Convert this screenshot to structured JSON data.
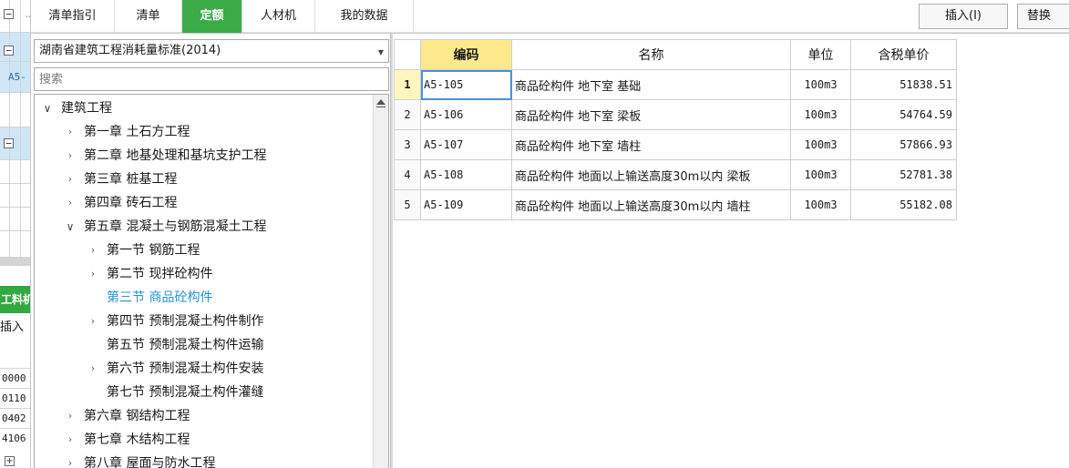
{
  "tabs": [
    {
      "label": "清单指引",
      "active": false
    },
    {
      "label": "清单",
      "active": false
    },
    {
      "label": "定额",
      "active": true
    },
    {
      "label": "人材机",
      "active": false
    },
    {
      "label": "我的数据",
      "active": false
    }
  ],
  "toolbar": {
    "insert_label": "插入(I)",
    "replace_label": "替换"
  },
  "left_strip": {
    "code_text": "A5-",
    "section_label": "工料机",
    "insert_label": "插入",
    "codes": [
      "0000",
      "0110",
      "0402",
      "4106"
    ]
  },
  "library": {
    "selected": "湖南省建筑工程消耗量标准(2014)"
  },
  "search": {
    "placeholder": "搜索"
  },
  "tree": [
    {
      "label": "建筑工程",
      "level": 0,
      "state": "expanded"
    },
    {
      "label": "第一章 土石方工程",
      "level": 1,
      "state": "collapsed"
    },
    {
      "label": "第二章 地基处理和基坑支护工程",
      "level": 1,
      "state": "collapsed"
    },
    {
      "label": "第三章 桩基工程",
      "level": 1,
      "state": "collapsed"
    },
    {
      "label": "第四章 砖石工程",
      "level": 1,
      "state": "collapsed"
    },
    {
      "label": "第五章 混凝土与钢筋混凝土工程",
      "level": 1,
      "state": "expanded"
    },
    {
      "label": "第一节 钢筋工程",
      "level": 2,
      "state": "collapsed"
    },
    {
      "label": "第二节 现拌砼构件",
      "level": 2,
      "state": "collapsed"
    },
    {
      "label": "第三节 商品砼构件",
      "level": 2,
      "state": "leaf",
      "selected": true
    },
    {
      "label": "第四节 预制混凝土构件制作",
      "level": 2,
      "state": "collapsed"
    },
    {
      "label": "第五节 预制混凝土构件运输",
      "level": 2,
      "state": "leaf"
    },
    {
      "label": "第六节 预制混凝土构件安装",
      "level": 2,
      "state": "collapsed"
    },
    {
      "label": "第七节 预制混凝土构件灌缝",
      "level": 2,
      "state": "leaf"
    },
    {
      "label": "第六章 钢结构工程",
      "level": 1,
      "state": "collapsed"
    },
    {
      "label": "第七章 木结构工程",
      "level": 1,
      "state": "collapsed"
    },
    {
      "label": "第八章 屋面与防水工程",
      "level": 1,
      "state": "collapsed"
    }
  ],
  "table": {
    "columns": [
      "编码",
      "名称",
      "单位",
      "含税单价"
    ],
    "rows": [
      {
        "idx": "1",
        "code": "A5-105",
        "name": "商品砼构件 地下室 基础",
        "unit": "100m3",
        "price": "51838.51",
        "selected": true
      },
      {
        "idx": "2",
        "code": "A5-106",
        "name": "商品砼构件 地下室 梁板",
        "unit": "100m3",
        "price": "54764.59"
      },
      {
        "idx": "3",
        "code": "A5-107",
        "name": "商品砼构件 地下室 墙柱",
        "unit": "100m3",
        "price": "57866.93"
      },
      {
        "idx": "4",
        "code": "A5-108",
        "name": "商品砼构件 地面以上输送高度30m以内 梁板",
        "unit": "100m3",
        "price": "52781.38"
      },
      {
        "idx": "5",
        "code": "A5-109",
        "name": "商品砼构件 地面以上输送高度30m以内 墙柱",
        "unit": "100m3",
        "price": "55182.08"
      }
    ]
  },
  "colors": {
    "active_tab": "#3aab47",
    "code_header": "#fde98c",
    "tree_selected": "#2395d6"
  }
}
